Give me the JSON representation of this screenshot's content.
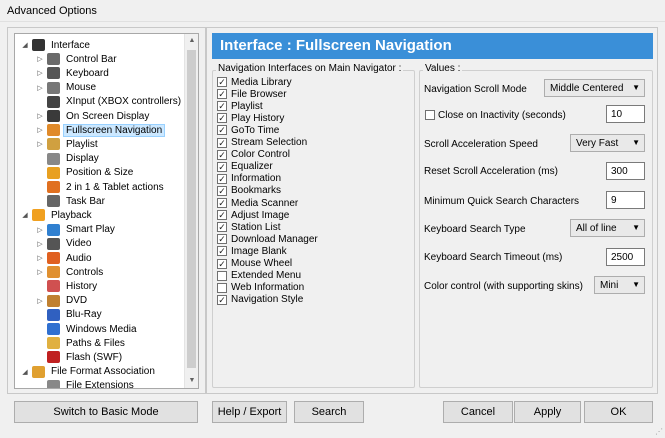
{
  "window": {
    "title": "Advanced Options"
  },
  "tree": {
    "items": [
      {
        "label": "Interface",
        "level": 0,
        "exp": "◢",
        "icon": "monitor-icon",
        "color": "#333"
      },
      {
        "label": "Control Bar",
        "level": 1,
        "exp": "▷",
        "icon": "control-bar-icon",
        "color": "#6a6a6a"
      },
      {
        "label": "Keyboard",
        "level": 1,
        "exp": "▷",
        "icon": "keyboard-icon",
        "color": "#555"
      },
      {
        "label": "Mouse",
        "level": 1,
        "exp": "▷",
        "icon": "mouse-icon",
        "color": "#777"
      },
      {
        "label": "XInput (XBOX controllers)",
        "level": 1,
        "exp": "",
        "icon": "gamepad-icon",
        "color": "#444"
      },
      {
        "label": "On Screen Display",
        "level": 1,
        "exp": "▷",
        "icon": "osd-icon",
        "color": "#3a3a3a"
      },
      {
        "label": "Fullscreen Navigation",
        "level": 1,
        "exp": "▷",
        "icon": "fullscreen-icon",
        "color": "#e08a2a"
      },
      {
        "label": "Playlist",
        "level": 1,
        "exp": "▷",
        "icon": "playlist-icon",
        "color": "#d0a040"
      },
      {
        "label": "Display",
        "level": 1,
        "exp": "",
        "icon": "display-icon",
        "color": "#888"
      },
      {
        "label": "Position & Size",
        "level": 1,
        "exp": "",
        "icon": "position-icon",
        "color": "#e8a020"
      },
      {
        "label": "2 in 1 & Tablet actions",
        "level": 1,
        "exp": "",
        "icon": "tablet-icon",
        "color": "#e07020"
      },
      {
        "label": "Task Bar",
        "level": 1,
        "exp": "",
        "icon": "taskbar-icon",
        "color": "#666"
      },
      {
        "label": "Playback",
        "level": 0,
        "exp": "◢",
        "icon": "playback-icon",
        "color": "#f0a020"
      },
      {
        "label": "Smart Play",
        "level": 1,
        "exp": "▷",
        "icon": "smart-play-icon",
        "color": "#3080d0"
      },
      {
        "label": "Video",
        "level": 1,
        "exp": "▷",
        "icon": "video-icon",
        "color": "#555"
      },
      {
        "label": "Audio",
        "level": 1,
        "exp": "▷",
        "icon": "audio-icon",
        "color": "#e06020"
      },
      {
        "label": "Controls",
        "level": 1,
        "exp": "▷",
        "icon": "controls-icon",
        "color": "#e09030"
      },
      {
        "label": "History",
        "level": 1,
        "exp": "",
        "icon": "history-icon",
        "color": "#d05050"
      },
      {
        "label": "DVD",
        "level": 1,
        "exp": "▷",
        "icon": "dvd-icon",
        "color": "#c08030"
      },
      {
        "label": "Blu-Ray",
        "level": 1,
        "exp": "",
        "icon": "bluray-icon",
        "color": "#3060c0"
      },
      {
        "label": "Windows Media",
        "level": 1,
        "exp": "",
        "icon": "windows-media-icon",
        "color": "#3070d0"
      },
      {
        "label": "Paths & Files",
        "level": 1,
        "exp": "",
        "icon": "folder-icon",
        "color": "#e0b040"
      },
      {
        "label": "Flash (SWF)",
        "level": 1,
        "exp": "",
        "icon": "flash-icon",
        "color": "#c02020"
      },
      {
        "label": "File Format Association",
        "level": 0,
        "exp": "◢",
        "icon": "file-assoc-icon",
        "color": "#e0a030"
      },
      {
        "label": "File Extensions",
        "level": 1,
        "exp": "",
        "icon": "file-ext-icon",
        "color": "#888"
      }
    ],
    "selected_index": 6
  },
  "header": {
    "title": "Interface : Fullscreen Navigation",
    "color": "#3a8fd8"
  },
  "nav_group": {
    "title": "Navigation Interfaces on Main Navigator :",
    "items": [
      {
        "label": "Media Library",
        "checked": true
      },
      {
        "label": "File Browser",
        "checked": true
      },
      {
        "label": "Playlist",
        "checked": true
      },
      {
        "label": "Play History",
        "checked": true
      },
      {
        "label": "GoTo Time",
        "checked": true
      },
      {
        "label": "Stream Selection",
        "checked": true
      },
      {
        "label": "Color Control",
        "checked": true
      },
      {
        "label": "Equalizer",
        "checked": true
      },
      {
        "label": "Information",
        "checked": true
      },
      {
        "label": "Bookmarks",
        "checked": true
      },
      {
        "label": "Media Scanner",
        "checked": true
      },
      {
        "label": "Adjust Image",
        "checked": true
      },
      {
        "label": "Station List",
        "checked": true
      },
      {
        "label": "Download Manager",
        "checked": true
      },
      {
        "label": "Image Blank",
        "checked": true
      },
      {
        "label": "Mouse Wheel",
        "checked": true
      },
      {
        "label": "Extended Menu",
        "checked": false
      },
      {
        "label": "Web Information",
        "checked": false
      },
      {
        "label": "Navigation Style",
        "checked": true
      }
    ]
  },
  "values_group": {
    "title": "Values :",
    "scroll_mode": {
      "label": "Navigation Scroll Mode",
      "value": "Middle Centered"
    },
    "close_inactivity": {
      "label": "Close on Inactivity (seconds)",
      "checked": false,
      "value": "10"
    },
    "scroll_accel_speed": {
      "label": "Scroll Acceleration Speed",
      "value": "Very Fast"
    },
    "reset_scroll_accel": {
      "label": "Reset Scroll Acceleration (ms)",
      "value": "300"
    },
    "min_quick_search": {
      "label": "Minimum Quick Search Characters",
      "value": "9"
    },
    "kb_search_type": {
      "label": "Keyboard Search Type",
      "value": "All of line"
    },
    "kb_search_timeout": {
      "label": "Keyboard Search Timeout (ms)",
      "value": "2500"
    },
    "color_control": {
      "label": "Color control (with supporting skins)",
      "value": "Mini"
    }
  },
  "buttons": {
    "basic_mode": "Switch to Basic Mode",
    "help_export": "Help / Export",
    "search": "Search",
    "cancel": "Cancel",
    "apply": "Apply",
    "ok": "OK"
  }
}
